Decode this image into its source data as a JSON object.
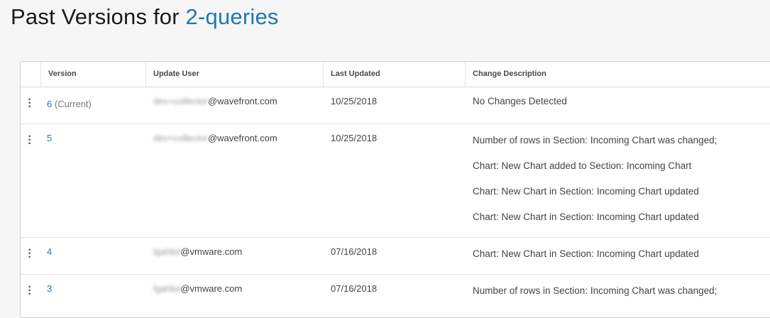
{
  "page": {
    "title_prefix": "Past Versions for ",
    "title_name": "2-queries"
  },
  "table": {
    "headers": {
      "version": "Version",
      "user": "Update User",
      "date": "Last Updated",
      "description": "Change Description"
    },
    "rows": [
      {
        "version": "6",
        "current_label": "(Current)",
        "user_hidden": "dev+collector",
        "user_domain": "@wavefront.com",
        "date": "10/25/2018",
        "changes": [
          "No Changes Detected"
        ]
      },
      {
        "version": "5",
        "current_label": "",
        "user_hidden": "dev+collector",
        "user_domain": "@wavefront.com",
        "date": "10/25/2018",
        "changes": [
          "Number of rows in Section: Incoming Chart was changed;",
          "Chart: New Chart added to Section: Incoming Chart",
          "Chart: New Chart in Section: Incoming Chart updated",
          "Chart: New Chart in Section: Incoming Chart updated"
        ]
      },
      {
        "version": "4",
        "current_label": "",
        "user_hidden": "lgahlot",
        "user_domain": "@vmware.com",
        "date": "07/16/2018",
        "changes": [
          "Chart: New Chart in Section: Incoming Chart updated"
        ]
      },
      {
        "version": "3",
        "current_label": "",
        "user_hidden": "lgahlot",
        "user_domain": "@vmware.com",
        "date": "07/16/2018",
        "changes": [
          "Number of rows in Section: Incoming Chart was changed;"
        ]
      }
    ]
  },
  "colors": {
    "link": "#1f77b4",
    "background": "#f6f6f6"
  }
}
